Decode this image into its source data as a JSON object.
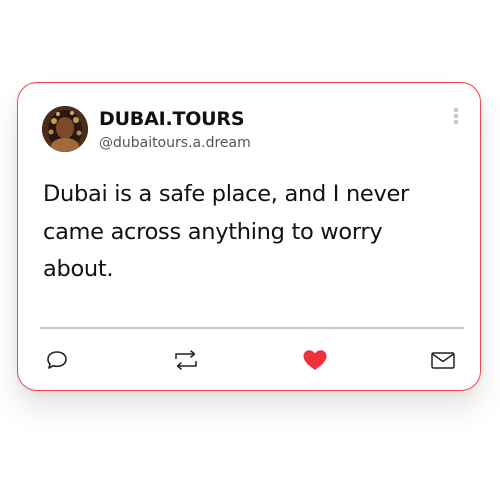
{
  "post": {
    "display_name": "DUBAI.TOURS",
    "handle": "@dubaitours.a.dream",
    "text": "Dubai is a safe place, and I never came across anything to worry about."
  },
  "actions": {
    "reply_icon": "speech-bubble-icon",
    "repost_icon": "repost-arrows-icon",
    "like_icon": "heart-icon",
    "share_icon": "envelope-icon",
    "like_color": "#f0303a"
  },
  "colors": {
    "card_border": "#f0484f",
    "text": "#111111",
    "handle": "#555555",
    "divider": "#c9c9c9"
  }
}
